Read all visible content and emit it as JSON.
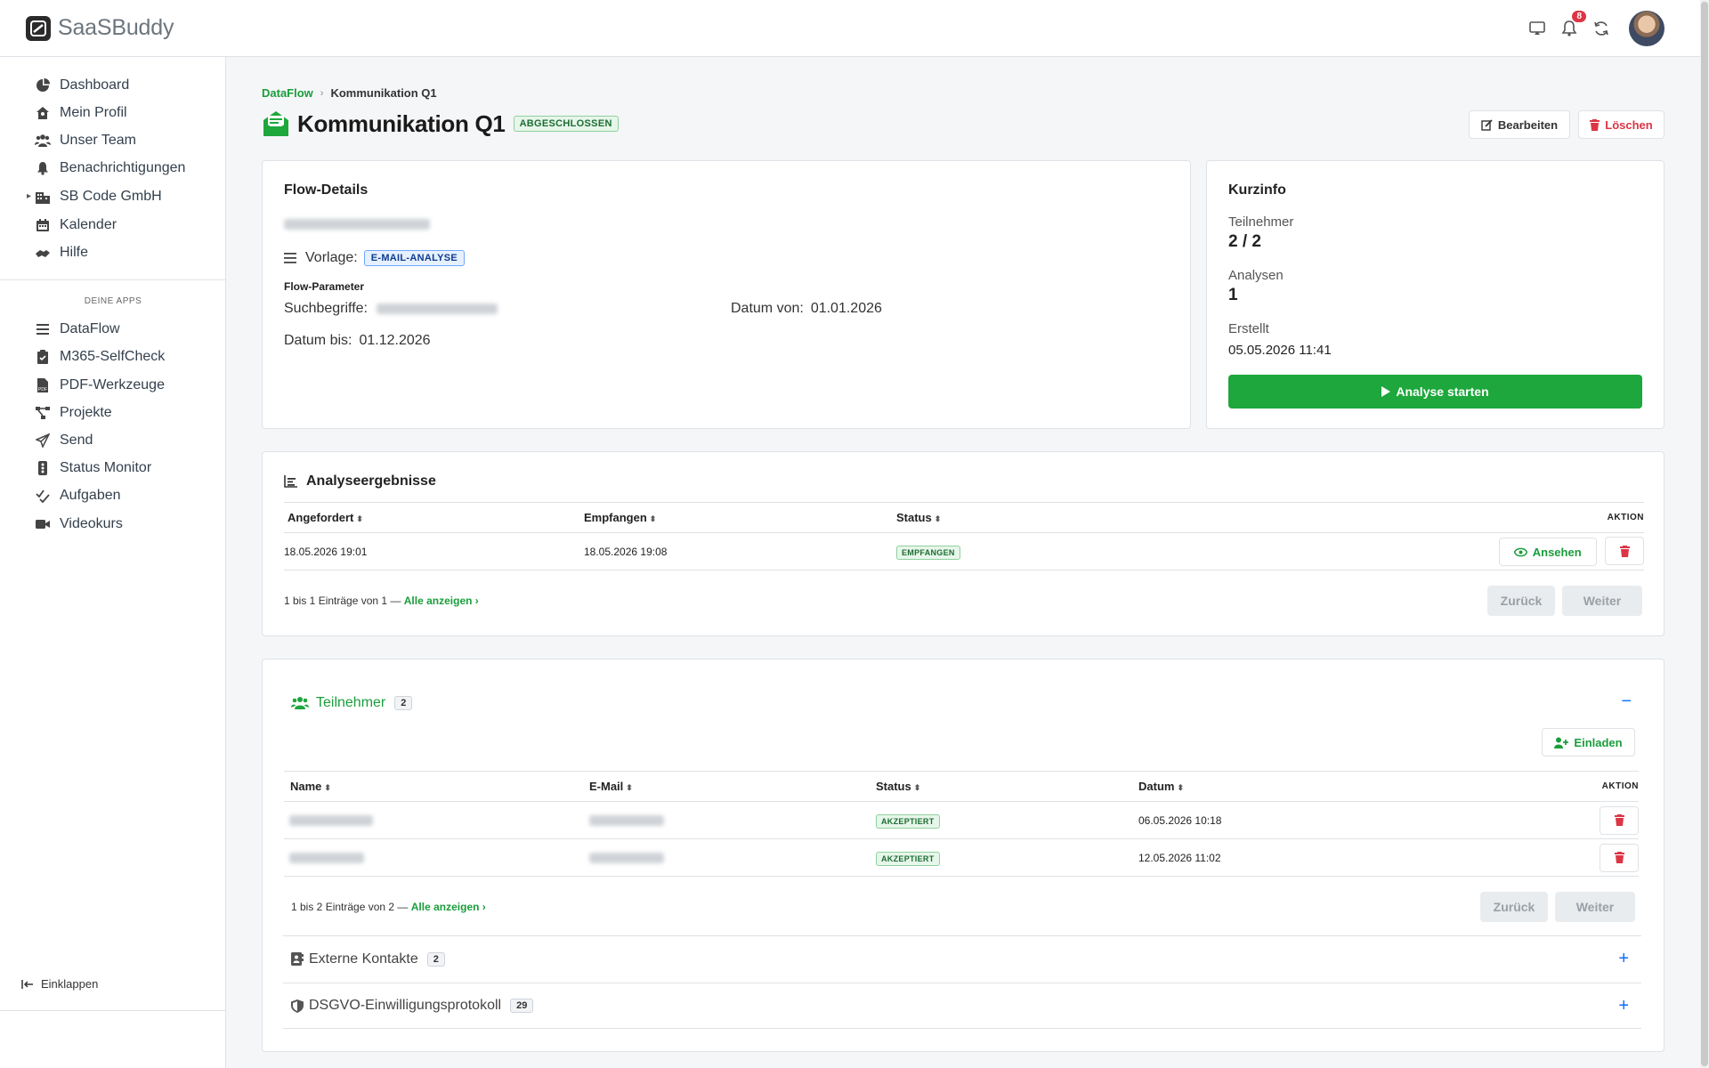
{
  "app": {
    "brand": "SaaSBuddy",
    "notifications_count": "8"
  },
  "sidebar": {
    "items": [
      {
        "label": "Dashboard",
        "icon": "dashboard-icon"
      },
      {
        "label": "Mein Profil",
        "icon": "profile-icon"
      },
      {
        "label": "Unser Team",
        "icon": "team-icon"
      },
      {
        "label": "Benachrichtigungen",
        "icon": "bell-icon"
      },
      {
        "label": "SB Code GmbH",
        "icon": "building-icon"
      },
      {
        "label": "Kalender",
        "icon": "calendar-icon"
      },
      {
        "label": "Hilfe",
        "icon": "help-icon"
      }
    ],
    "section_title": "DEINE APPS",
    "apps": [
      {
        "label": "DataFlow",
        "icon": "list-icon"
      },
      {
        "label": "M365-SelfCheck",
        "icon": "clipboard-icon"
      },
      {
        "label": "PDF-Werkzeuge",
        "icon": "pdf-icon"
      },
      {
        "label": "Projekte",
        "icon": "project-icon"
      },
      {
        "label": "Send",
        "icon": "send-icon"
      },
      {
        "label": "Status Monitor",
        "icon": "status-icon"
      },
      {
        "label": "Aufgaben",
        "icon": "tasks-icon"
      },
      {
        "label": "Videokurs",
        "icon": "video-icon"
      }
    ],
    "collapse_label": "Einklappen"
  },
  "breadcrumb": {
    "parent": "DataFlow",
    "current": "Kommunikation Q1"
  },
  "page": {
    "title": "Kommunikation Q1",
    "status_badge": "ABGESCHLOSSEN",
    "edit_label": "Bearbeiten",
    "delete_label": "Löschen"
  },
  "flow_details": {
    "title": "Flow-Details",
    "template_label": "Vorlage:",
    "template_badge": "E-MAIL-ANALYSE",
    "params_title": "Flow-Parameter",
    "search_terms_label": "Suchbegriffe:",
    "date_from_label": "Datum von:",
    "date_from_value": "01.01.2026",
    "date_to_label": "Datum bis:",
    "date_to_value": "01.12.2026"
  },
  "quick_info": {
    "title": "Kurzinfo",
    "participants_label": "Teilnehmer",
    "participants_value": "2 / 2",
    "analyses_label": "Analysen",
    "analyses_value": "1",
    "created_label": "Erstellt",
    "created_value": "05.05.2026 11:41",
    "start_button": "Analyse starten"
  },
  "results": {
    "title": "Analyseergebnisse",
    "columns": [
      "Angefordert",
      "Empfangen",
      "Status",
      "AKTION"
    ],
    "rows": [
      {
        "requested": "18.05.2026 19:01",
        "received": "18.05.2026 19:08",
        "status": "EMPFANGEN",
        "view_label": "Ansehen"
      }
    ],
    "pager_text": "1 bis 1 Einträge von 1 —",
    "show_all": "Alle anzeigen",
    "prev": "Zurück",
    "next": "Weiter"
  },
  "participants": {
    "title": "Teilnehmer",
    "count": "2",
    "invite_label": "Einladen",
    "columns": [
      "Name",
      "E-Mail",
      "Status",
      "Datum",
      "AKTION"
    ],
    "rows": [
      {
        "status": "AKZEPTIERT",
        "date": "06.05.2026 10:18"
      },
      {
        "status": "AKZEPTIERT",
        "date": "12.05.2026 11:02"
      }
    ],
    "pager_text": "1 bis 2 Einträge von 2 —",
    "show_all": "Alle anzeigen",
    "prev": "Zurück",
    "next": "Weiter"
  },
  "external_contacts": {
    "title": "Externe Kontakte",
    "count": "2"
  },
  "gdpr_log": {
    "title": "DSGVO-Einwilligungsprotokoll",
    "count": "29"
  },
  "colors": {
    "accent": "#1da73c",
    "danger": "#dc3545",
    "link_blue": "#0d6efd"
  }
}
